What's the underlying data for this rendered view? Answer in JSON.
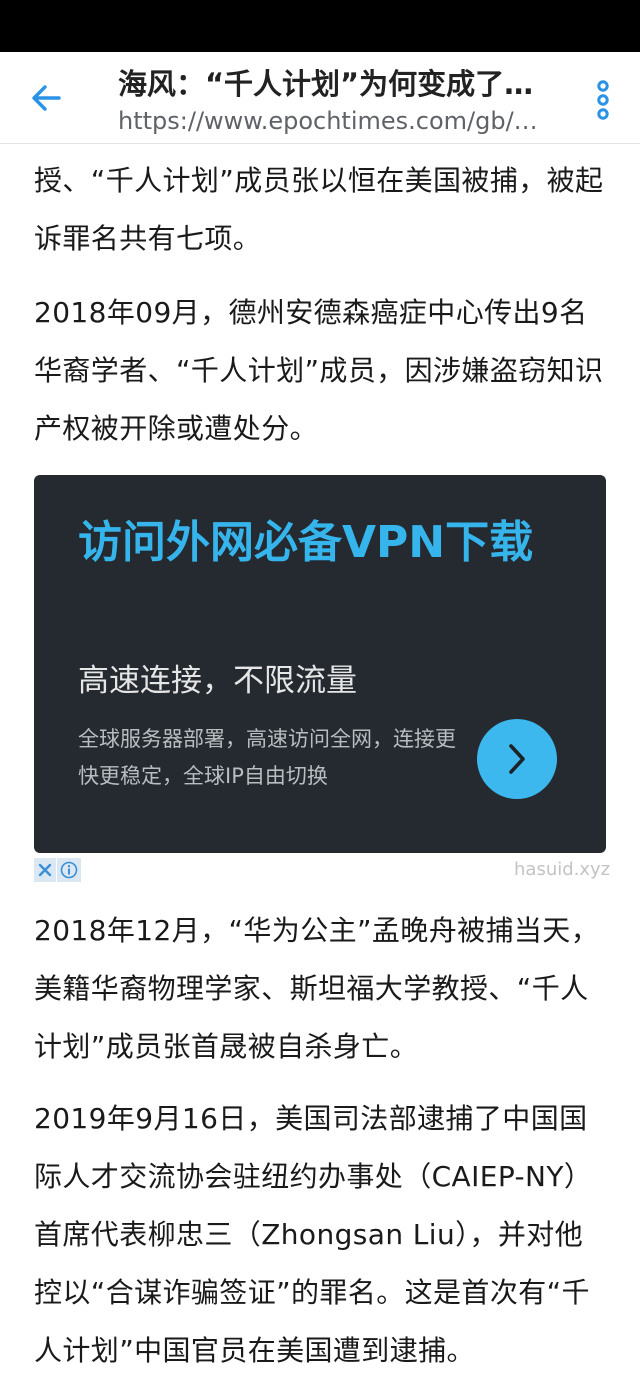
{
  "toolbar": {
    "title": "海风：“千人计划”为何变成了…",
    "url": "https://www.epochtimes.com/gb/…",
    "back_icon": "arrow-left-icon",
    "menu_icon": "more-vertical-icon",
    "accent_color": "#2b93e6"
  },
  "article": {
    "paragraphs": [
      "授、“千人计划”成员张以恒在美国被捕，被起诉罪名共有七项。",
      "2018年09月，德州安德森癌症中心传出9名华裔学者、“千人计划”成员，因涉嫌盗窃知识产权被开除或遭处分。",
      "2018年12月，“华为公主”孟晚舟被捕当天，美籍华裔物理学家、斯坦福大学教授、“千人计划”成员张首晟被自杀身亡。",
      "2019年9月16日，美国司法部逮捕了中国国际人才交流协会驻纽约办事处（CAIEP-NY）首席代表柳忠三（Zhongsan Liu），并对他控以“合谋诈骗签证”的罪名。这是首次有“千人计划”中国官员在美国遭到逮捕。"
    ]
  },
  "ad": {
    "headline": "访问外网必备VPN下载",
    "subheadline": "高速连接，不限流量",
    "description": "全球服务器部署，高速访问全网，连接更快更稳定，全球IP自由切换",
    "arrow_icon": "chevron-right-icon",
    "close_icon": "close-icon",
    "info_icon": "info-icon",
    "domain": "hasuid.xyz",
    "bg_color": "#242a30",
    "accent_color": "#3db8ef"
  }
}
